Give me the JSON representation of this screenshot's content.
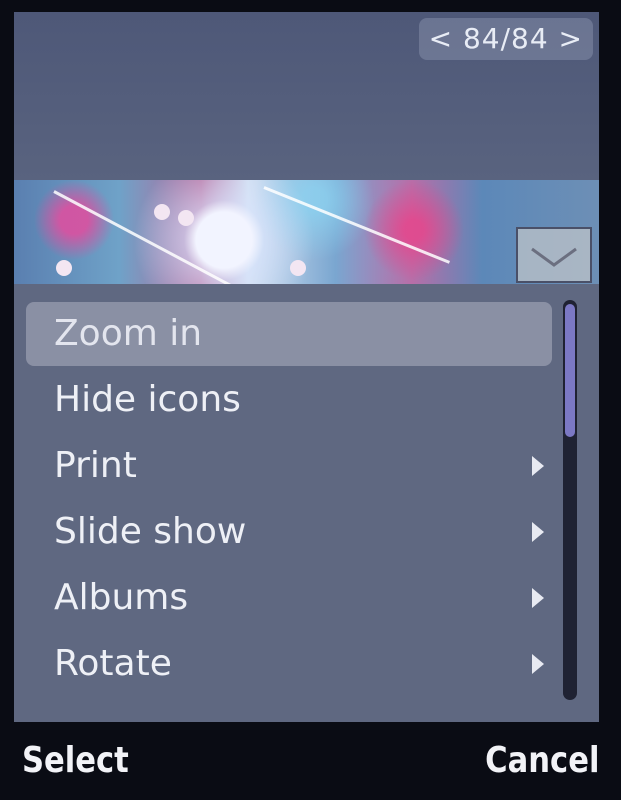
{
  "viewer": {
    "counter": "< 84/84 >"
  },
  "menu": {
    "items": [
      {
        "label": "Zoom in",
        "submenu": false,
        "highlighted": true
      },
      {
        "label": "Hide icons",
        "submenu": false,
        "highlighted": false
      },
      {
        "label": "Print",
        "submenu": true,
        "highlighted": false
      },
      {
        "label": "Slide show",
        "submenu": true,
        "highlighted": false
      },
      {
        "label": "Albums",
        "submenu": true,
        "highlighted": false
      },
      {
        "label": "Rotate",
        "submenu": true,
        "highlighted": false
      }
    ],
    "scroll_fraction": 0.34
  },
  "softkeys": {
    "left": "Select",
    "right": "Cancel"
  },
  "colors": {
    "menu_background": "#5f6881",
    "highlight": "#8a90a4",
    "scroll_thumb": "#7b78c4"
  },
  "icons": {
    "dropdown": "chevron-down-icon",
    "submenu": "triangle-right-icon"
  }
}
